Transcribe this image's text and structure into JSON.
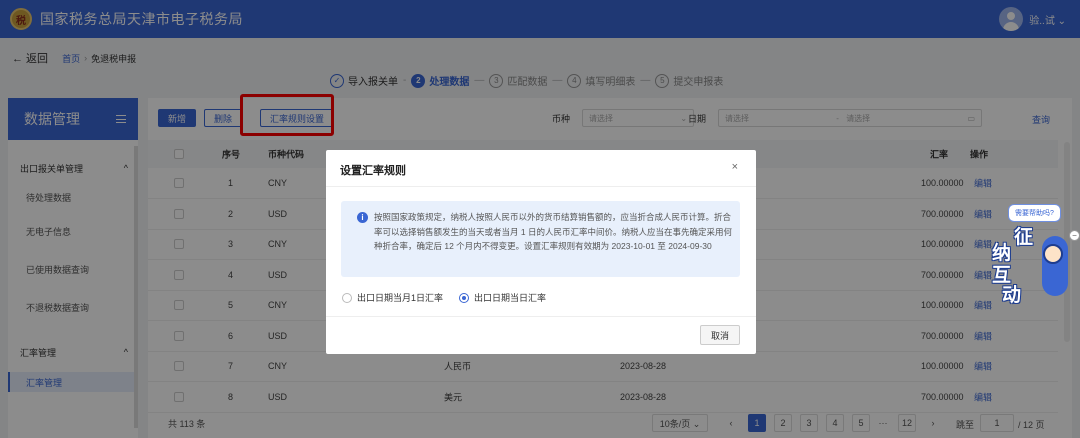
{
  "header": {
    "brand": "国家税务总局天津市电子税务局",
    "logo_glyph": "税",
    "user": "验..试 ⌄"
  },
  "breadcrumb": {
    "back": "← 返回",
    "home": "首页",
    "sep": "›",
    "current": "免退税申报"
  },
  "steps": [
    {
      "num": "✓",
      "label": "导入报关单",
      "state": "done"
    },
    {
      "num": "2",
      "label": "处理数据",
      "state": "active"
    },
    {
      "num": "3",
      "label": "匹配数据",
      "state": "todo"
    },
    {
      "num": "4",
      "label": "填写明细表",
      "state": "todo"
    },
    {
      "num": "5",
      "label": "提交申报表",
      "state": "todo"
    }
  ],
  "sidebar": {
    "title": "数据管理",
    "groups": [
      {
        "label": "出口报关单管理",
        "items": [
          "待处理数据",
          "无电子信息",
          "已使用数据查询",
          "不退税数据查询"
        ]
      },
      {
        "label": "汇率管理",
        "items": [
          "汇率管理"
        ]
      }
    ]
  },
  "toolbar": {
    "add": "新增",
    "delete": "删除",
    "rate_rule": "汇率规则设置"
  },
  "filters": {
    "currency_label": "币种",
    "currency_placeholder": "请选择",
    "date_label": "日期",
    "date_start": "请选择",
    "date_sep": "-",
    "date_end": "请选择",
    "query": "查询"
  },
  "table": {
    "headers": {
      "seq": "序号",
      "code": "币种代码",
      "rate": "汇率",
      "action": "操作"
    },
    "rows": [
      {
        "seq": "1",
        "code": "CNY",
        "name": "",
        "date": "",
        "rate": "100.00000",
        "action": "编辑"
      },
      {
        "seq": "2",
        "code": "USD",
        "name": "",
        "date": "",
        "rate": "700.00000",
        "action": "编辑"
      },
      {
        "seq": "3",
        "code": "CNY",
        "name": "",
        "date": "",
        "rate": "100.00000",
        "action": "编辑"
      },
      {
        "seq": "4",
        "code": "USD",
        "name": "",
        "date": "",
        "rate": "700.00000",
        "action": "编辑"
      },
      {
        "seq": "5",
        "code": "CNY",
        "name": "",
        "date": "",
        "rate": "100.00000",
        "action": "编辑"
      },
      {
        "seq": "6",
        "code": "USD",
        "name": "",
        "date": "",
        "rate": "700.00000",
        "action": "编辑"
      },
      {
        "seq": "7",
        "code": "CNY",
        "name": "人民币",
        "date": "2023-08-28",
        "rate": "100.00000",
        "action": "编辑"
      },
      {
        "seq": "8",
        "code": "USD",
        "name": "美元",
        "date": "2023-08-28",
        "rate": "700.00000",
        "action": "编辑"
      }
    ]
  },
  "pager": {
    "total": "共 113 条",
    "page_size": "10条/页 ⌄",
    "prev": "‹",
    "pages": [
      "1",
      "2",
      "3",
      "4",
      "5",
      "···",
      "12"
    ],
    "next": "›",
    "jump_label": "跳至",
    "jump_value": "1",
    "total_pages": "/ 12 页"
  },
  "modal": {
    "title": "设置汇率规则",
    "close": "×",
    "notice": "按照国家政策规定，纳税人按照人民币以外的货币结算销售额的，应当折合成人民币计算。折合率可以选择销售额发生的当天或者当月 1 日的人民币汇率中间价。纳税人应当在事先确定采用何种折合率，确定后 12 个月内不得变更。设置汇率规则有效期为 2023-10-01 至 2024-09-30",
    "options": [
      {
        "label": "出口日期当月1日汇率",
        "selected": false
      },
      {
        "label": "出口日期当日汇率",
        "selected": true
      }
    ],
    "cancel": "取消"
  },
  "helper": {
    "bubble": "需要帮助吗?",
    "chars": [
      "征",
      "纳",
      "互",
      "动"
    ],
    "side_tab": "−"
  },
  "colors": {
    "primary": "#3a66d3",
    "highlight": "#ff0000"
  }
}
